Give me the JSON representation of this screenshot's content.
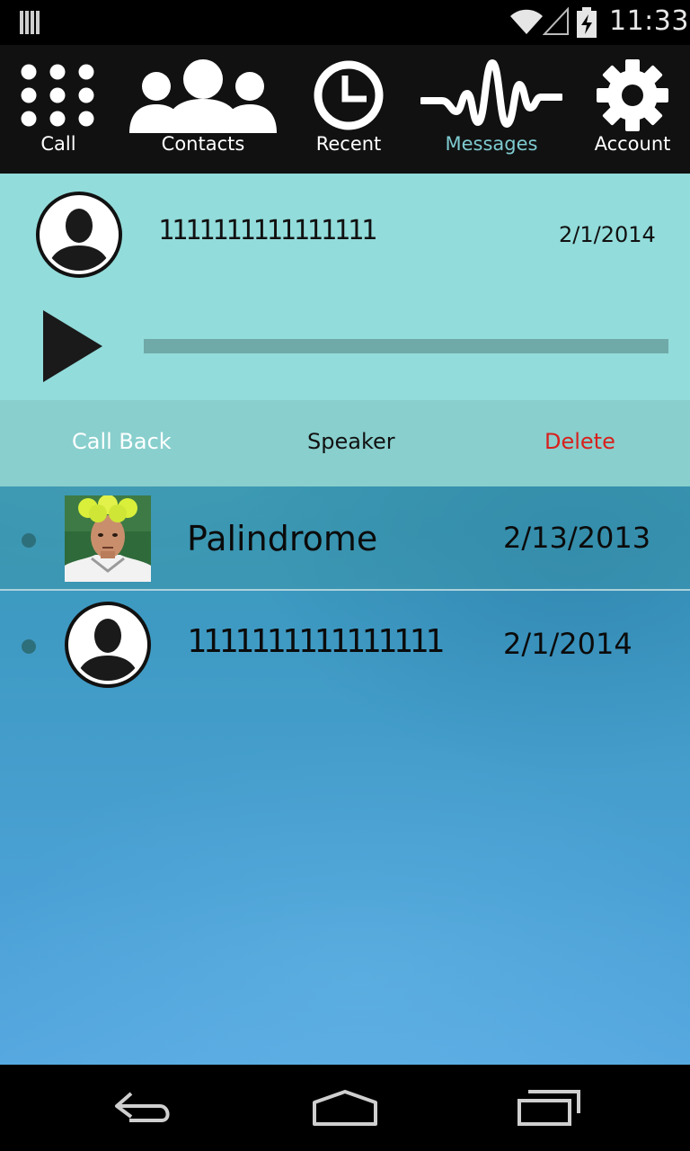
{
  "status_bar": {
    "time": "11:33",
    "icons": [
      "notification-bars-icon",
      "wifi-icon",
      "cell-signal-icon",
      "battery-charging-icon"
    ]
  },
  "nav": {
    "items": [
      {
        "label": "Call",
        "icon": "dialpad-icon"
      },
      {
        "label": "Contacts",
        "icon": "contacts-icon"
      },
      {
        "label": "Recent",
        "icon": "clock-icon"
      },
      {
        "label": "Messages",
        "icon": "waveform-icon",
        "active": true
      },
      {
        "label": "Account",
        "icon": "gear-icon"
      }
    ]
  },
  "expanded_message": {
    "number": "1111111111111111",
    "date": "2/1/2014",
    "progress": 0
  },
  "actions": {
    "call_back": "Call Back",
    "speaker": "Speaker",
    "delete": "Delete"
  },
  "messages": [
    {
      "name": "Palindrome",
      "date": "2/13/2013",
      "avatar": "photo"
    },
    {
      "name": "1111111111111111",
      "date": "2/1/2014",
      "avatar": "default-person"
    }
  ],
  "colors": {
    "accent": "#7ecbd1",
    "expanded_bg": "#92dcdb",
    "action_bar_bg": "#88cfcd",
    "delete": "#d8201c"
  },
  "bottom_nav": [
    "back-icon",
    "home-icon",
    "recent-apps-icon"
  ]
}
